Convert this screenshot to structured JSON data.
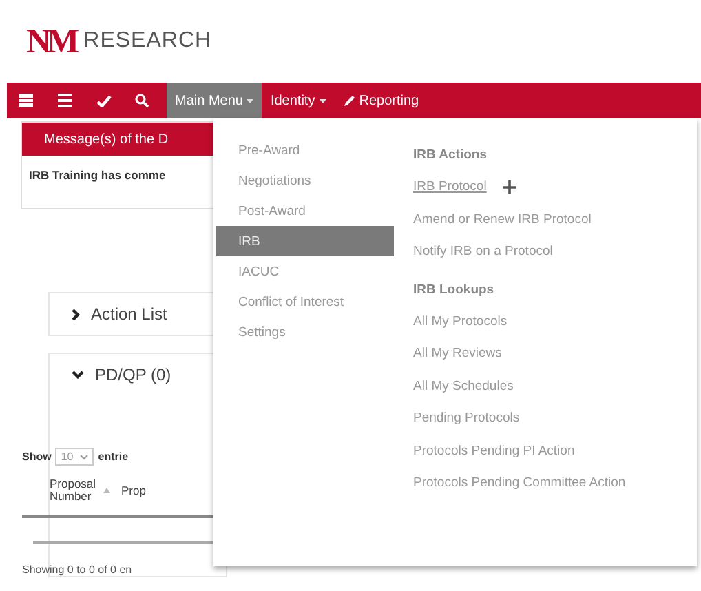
{
  "header": {
    "logo": "NM",
    "title": "RESEARCH"
  },
  "navbar": {
    "items": [
      {
        "label": "Main Menu",
        "caret": true,
        "selected": true
      },
      {
        "label": "Identity",
        "caret": true,
        "selected": false
      },
      {
        "label": "Reporting",
        "caret": false,
        "selected": false
      }
    ]
  },
  "messages": {
    "title": "Message(s) of the D",
    "text": "IRB Training has comme"
  },
  "panels": [
    {
      "title": "Action List",
      "expanded": false
    },
    {
      "title": "PD/QP (0)",
      "expanded": true
    }
  ],
  "table": {
    "show_label": "Show",
    "page_size": "10",
    "entries_label": "entrie",
    "columns": [
      {
        "label": "Proposal Number",
        "sorted": true
      },
      {
        "label": "Prop",
        "sorted": false
      }
    ],
    "info": "Showing 0 to 0 of 0 en"
  },
  "main_menu": {
    "sections": [
      {
        "label": "Pre-Award",
        "selected": false
      },
      {
        "label": "Negotiations",
        "selected": false
      },
      {
        "label": "Post-Award",
        "selected": false
      },
      {
        "label": "IRB",
        "selected": true
      },
      {
        "label": "IACUC",
        "selected": false
      },
      {
        "label": "Conflict of Interest",
        "selected": false
      },
      {
        "label": "Settings",
        "selected": false
      }
    ],
    "groups": [
      {
        "title": "IRB Actions",
        "items": [
          {
            "label": "IRB Protocol",
            "hovered": true,
            "add": true
          },
          {
            "label": "Amend or Renew IRB Protocol",
            "hovered": false,
            "add": false
          },
          {
            "label": "Notify IRB on a Protocol",
            "hovered": false,
            "add": false
          }
        ]
      },
      {
        "title": "IRB Lookups",
        "items": [
          {
            "label": "All My Protocols",
            "hovered": false,
            "add": false
          },
          {
            "label": "All My Reviews",
            "hovered": false,
            "add": false
          },
          {
            "label": "All My Schedules",
            "hovered": false,
            "add": false
          },
          {
            "label": "Pending Protocols",
            "hovered": false,
            "add": false
          },
          {
            "label": "Protocols Pending PI Action",
            "hovered": false,
            "add": false
          },
          {
            "label": "Protocols Pending Committee Action",
            "hovered": false,
            "add": false
          }
        ]
      }
    ]
  }
}
